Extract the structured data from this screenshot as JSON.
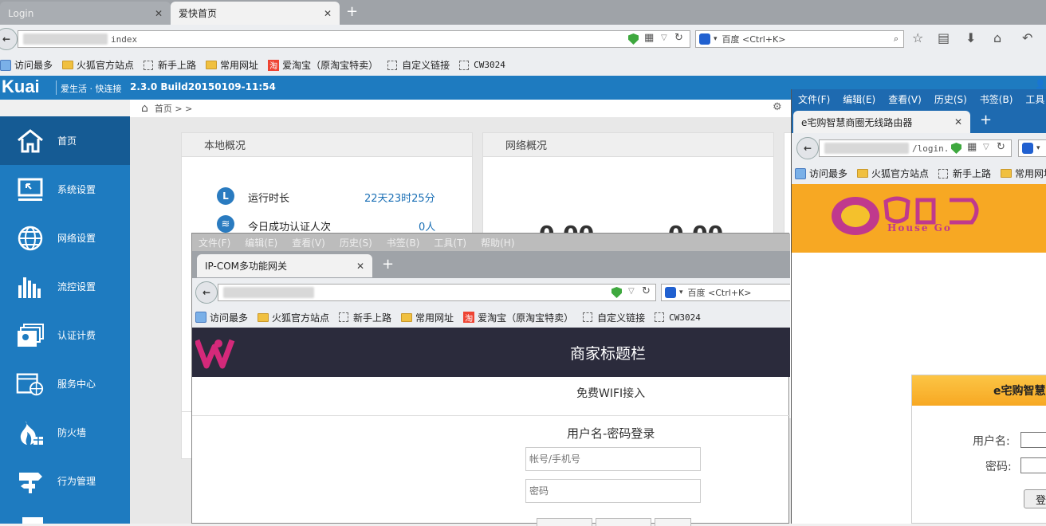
{
  "browser": {
    "tabs": [
      {
        "label": "Login"
      },
      {
        "label": "爱快首页"
      }
    ],
    "url": "index",
    "search_placeholder": "百度 <Ctrl+K>",
    "bookmarks": [
      "访问最多",
      "火狐官方站点",
      "新手上路",
      "常用网址",
      "爱淘宝（原淘宝特卖）",
      "自定义链接",
      "CW3024"
    ]
  },
  "ikuai": {
    "logo": "Kuai",
    "slogan": "爱生活 · 快连接",
    "version": "2.3.0 Build20150109-11:54",
    "breadcrumb": "首页 > >",
    "sidebar": [
      {
        "label": "首页",
        "icon": "home-icon"
      },
      {
        "label": "系统设置",
        "icon": "monitor-icon"
      },
      {
        "label": "网络设置",
        "icon": "globe-icon"
      },
      {
        "label": "流控设置",
        "icon": "bars-icon"
      },
      {
        "label": "认证计费",
        "icon": "cards-icon"
      },
      {
        "label": "服务中心",
        "icon": "browser-globe-icon"
      },
      {
        "label": "防火墙",
        "icon": "fire-icon"
      },
      {
        "label": "行为管理",
        "icon": "signpost-icon"
      }
    ],
    "panels": {
      "local": {
        "title": "本地概况",
        "rows": [
          {
            "label": "运行时长",
            "value": "22天23时25分",
            "icon": "clock-icon"
          },
          {
            "label": "今日成功认证人次",
            "value": "0人",
            "icon": "wifi-icon"
          }
        ]
      },
      "network": {
        "title": "网络概况",
        "values": [
          "0.00",
          "0.00"
        ]
      }
    }
  },
  "ipcom": {
    "menu": [
      "文件(F)",
      "编辑(E)",
      "查看(V)",
      "历史(S)",
      "书签(B)",
      "工具(T)",
      "帮助(H)"
    ],
    "tab": "IP-COM多功能网关",
    "search_placeholder": "百度 <Ctrl+K>",
    "bookmarks": [
      "访问最多",
      "火狐官方站点",
      "新手上路",
      "常用网址",
      "爱淘宝（原淘宝特卖）",
      "自定义链接",
      "CW3024"
    ],
    "banner_title": "商家标题栏",
    "wifi_text": "免费WIFI接入",
    "login_title": "用户名-密码登录",
    "account_placeholder": "帐号/手机号",
    "password_placeholder": "密码"
  },
  "eshop": {
    "menu": [
      "文件(F)",
      "编辑(E)",
      "查看(V)",
      "历史(S)",
      "书签(B)",
      "工具"
    ],
    "tab": "e宅购智慧商圈无线路由器",
    "url": "/login.",
    "bookmarks": [
      "访问最多",
      "火狐官方站点",
      "新手上路",
      "常用网址"
    ],
    "logo_text": "House Go",
    "form_title": "e宅购智慧",
    "username_label": "用户名:",
    "password_label": "密码:",
    "login_button": "登"
  }
}
